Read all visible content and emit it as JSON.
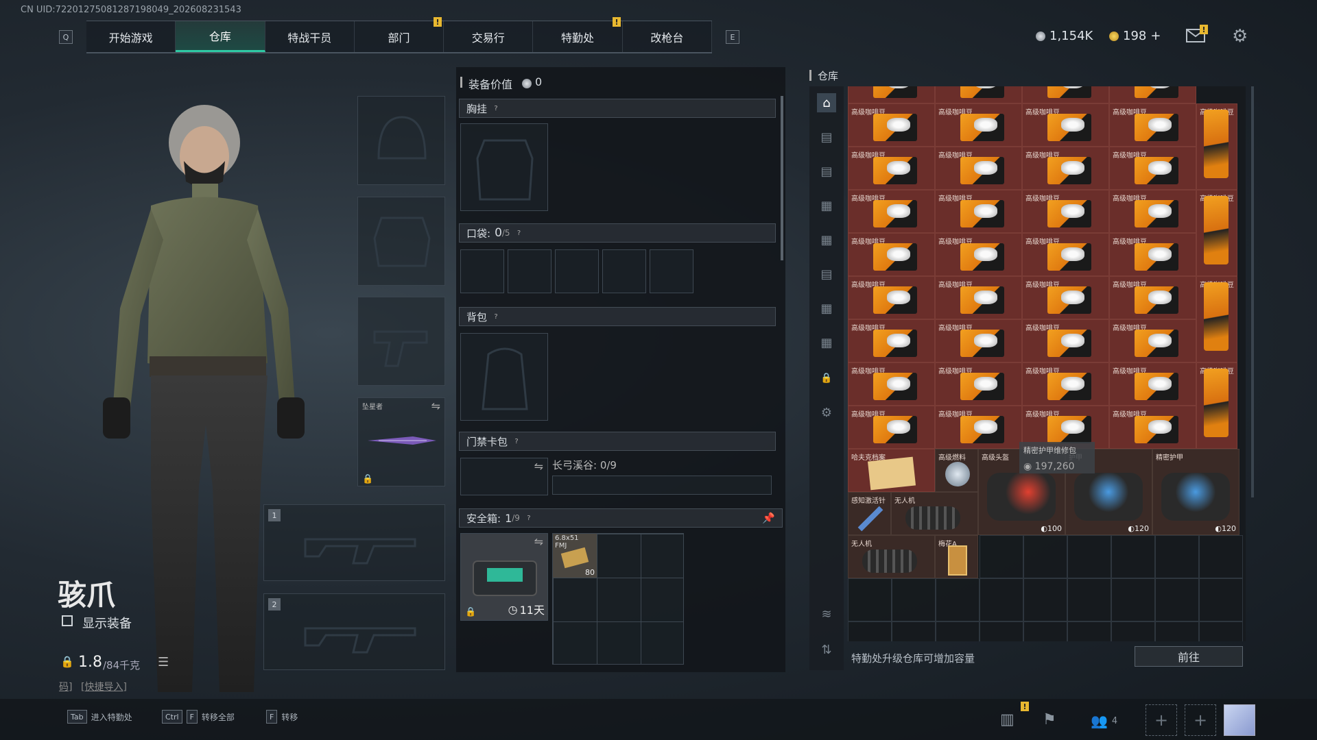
{
  "uid": "CN UID:7220127508128719804­9_202608231543",
  "nav": {
    "left_key": "Q",
    "right_key": "E",
    "tabs": [
      "开始游戏",
      "仓库",
      "特战干员",
      "部门",
      "交易行",
      "特勤处",
      "改枪台"
    ],
    "active": "仓库"
  },
  "currency": {
    "silver": "1,154K",
    "gold": "198",
    "plus": "+"
  },
  "operator": {
    "name": "骇爪",
    "show_gear_label": "显示装备",
    "weight": "1.8",
    "weight_max": "/84千克",
    "import_code": "码]",
    "quick_import": "[快捷导入]"
  },
  "gear": {
    "melee_label": "坠星者",
    "weapon_slot_1": "1",
    "weapon_slot_2": "2"
  },
  "loadout": {
    "value_label": "装备价值",
    "value": "0",
    "chest_rig": "胸挂",
    "pockets_label": "口袋:",
    "pockets_value": "0",
    "pockets_max": "/5",
    "backpack": "背包",
    "keycard": "门禁卡包",
    "keycard_map": "长弓溪谷: 0/9",
    "safebox_label": "安全箱:",
    "safebox_value": "1",
    "safebox_max": "/9",
    "safebox_timer": "11天",
    "ammo_name": "6.8x51",
    "ammo_sub": "FMJ",
    "ammo_count": "80"
  },
  "warehouse": {
    "title": "仓库",
    "item_coffee": "高级咖啡豆",
    "hover_name": "精密护甲维修包",
    "hover_value": "197,260",
    "misc": {
      "archive": "哈夫克档案",
      "fuel": "高级燃料",
      "helmet": "高级头盔",
      "armor": "护甲",
      "armor2": "精密护甲",
      "injector": "感知激活针",
      "drone": "无人机",
      "drone2": "无人机",
      "plum": "梅花A"
    },
    "durability": [
      "100",
      "120",
      "120"
    ],
    "upgrade_hint": "特勤处升级仓库可增加容量",
    "goto": "前往"
  },
  "bottom": {
    "tab_key": "Tab",
    "tab_hint": "进入特勤处",
    "ctrl_key": "Ctrl",
    "f_key": "F",
    "ctrl_hint": "转移全部",
    "f_key2": "F",
    "f_hint": "转移",
    "squad": "4"
  },
  "colors": {
    "accent": "#2fc9a4",
    "item_bg": "#6a2e2a",
    "marker": "#e8b830"
  }
}
